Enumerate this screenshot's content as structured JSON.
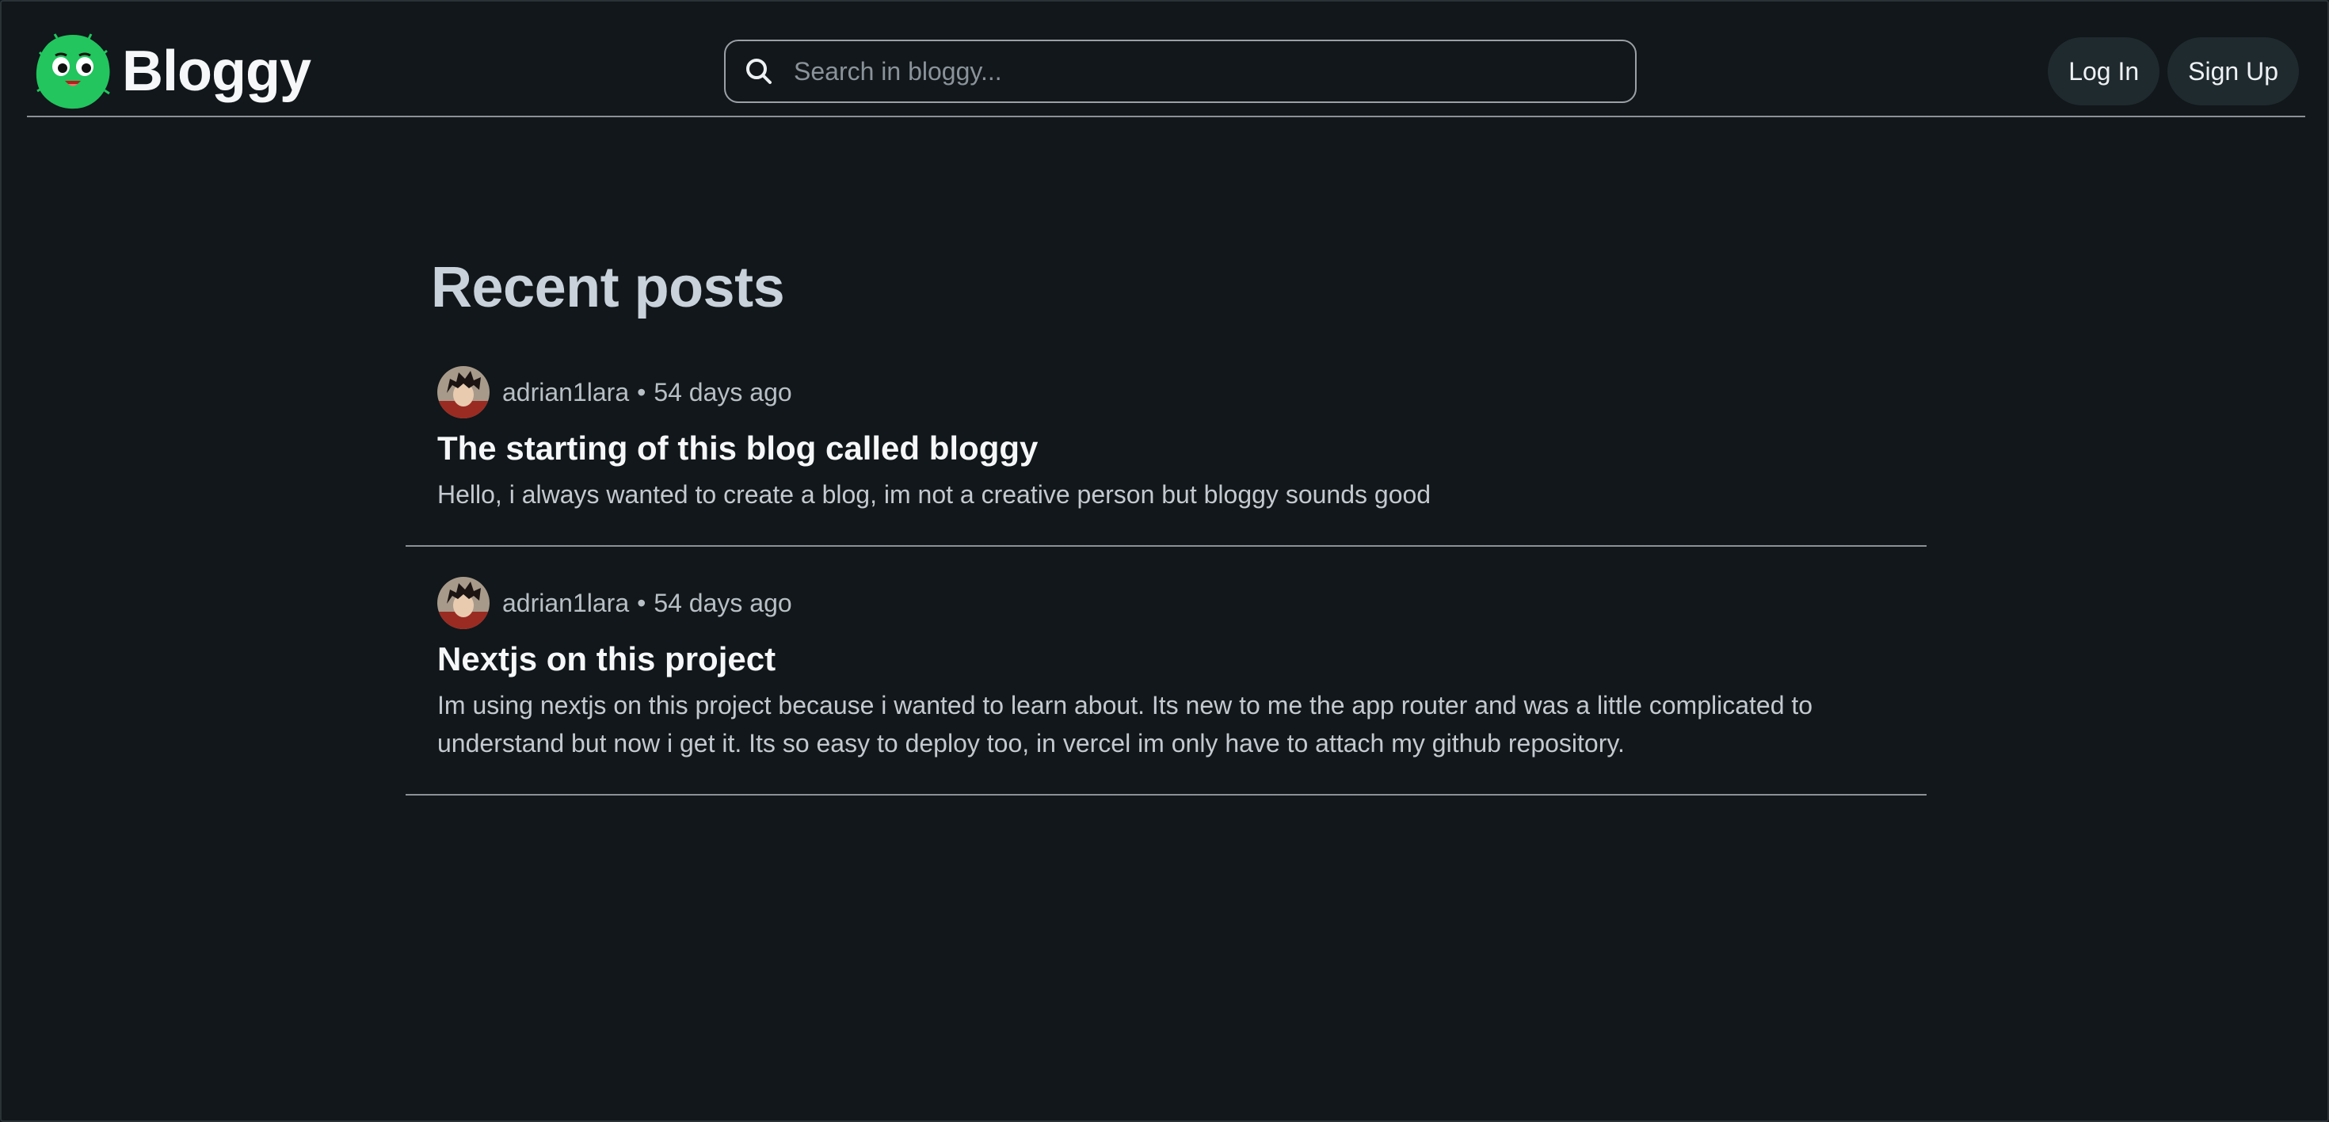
{
  "header": {
    "brand_name": "Bloggy",
    "logo_icon": "smiling-green-face-logo",
    "search": {
      "placeholder": "Search in bloggy...",
      "value": "",
      "icon": "search-icon"
    },
    "login_label": "Log In",
    "signup_label": "Sign Up"
  },
  "main": {
    "title": "Recent posts",
    "posts": [
      {
        "author": "adrian1lara",
        "separator": "•",
        "time_ago": "54 days ago",
        "title": "The starting of this blog called bloggy",
        "excerpt": "Hello, i always wanted to create a blog, im not a creative person but bloggy sounds good"
      },
      {
        "author": "adrian1lara",
        "separator": "•",
        "time_ago": "54 days ago",
        "title": "Nextjs on this project",
        "excerpt": "Im using nextjs on this project because i wanted to learn about. Its new to me the app router and was a little complicated to understand but now i get it. Its so easy to deploy too, in vercel im only have to attach my github repository."
      }
    ]
  },
  "colors": {
    "background": "#11171a",
    "brand_green": "#22c55e",
    "button_bg": "#1f2a2f",
    "divider": "#8b9196"
  }
}
